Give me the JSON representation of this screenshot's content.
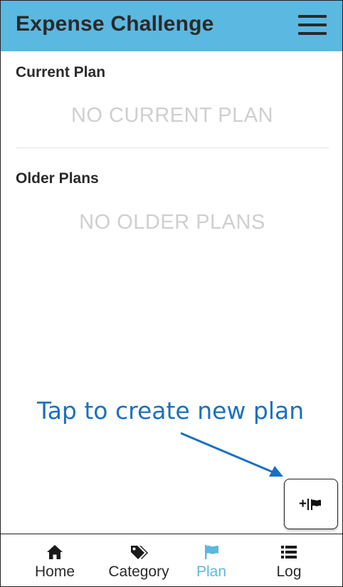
{
  "app": {
    "title": "Expense Challenge",
    "accent_color": "#5bb8e0",
    "menu_icon": "hamburger-menu-icon"
  },
  "current_plan": {
    "heading": "Current Plan",
    "empty_text": "NO CURRENT PLAN"
  },
  "older_plans": {
    "heading": "Older Plans",
    "empty_text": "NO OLDER PLANS"
  },
  "annotation": {
    "text": "Tap to create new plan",
    "color": "#1a70c0"
  },
  "fab": {
    "plus_label": "+",
    "icon": "flag-icon"
  },
  "bottom_nav": {
    "items": [
      {
        "label": "Home",
        "icon": "home-icon",
        "active": false
      },
      {
        "label": "Category",
        "icon": "tags-icon",
        "active": false
      },
      {
        "label": "Plan",
        "icon": "flag-icon",
        "active": true
      },
      {
        "label": "Log",
        "icon": "list-icon",
        "active": false
      }
    ]
  }
}
